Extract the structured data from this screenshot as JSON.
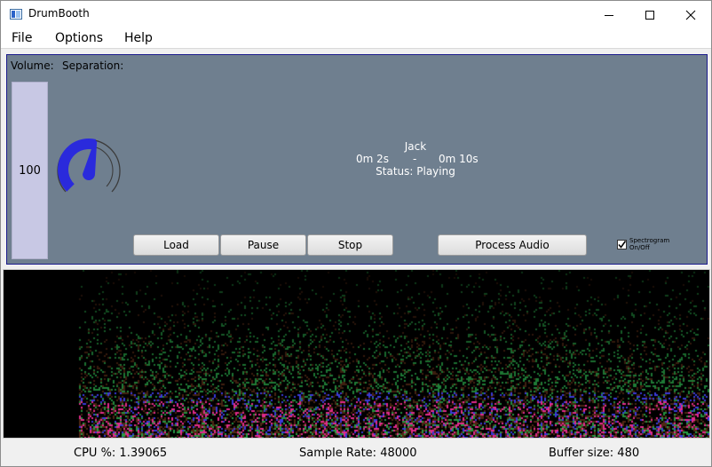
{
  "window": {
    "title": "DrumBooth",
    "icon": "app-icon"
  },
  "titlebar_buttons": {
    "minimize": "minimize-icon",
    "maximize": "maximize-icon",
    "close": "close-icon"
  },
  "menu": [
    "File",
    "Options",
    "Help"
  ],
  "controls": {
    "volume_label": "Volume:",
    "separation_label": "Separation:",
    "volume_value": "100",
    "separation_level": 0.55,
    "colors": {
      "panel": "#6f7f8f",
      "knob_fill": "#2a2adc",
      "slider": "#c8c8e4"
    }
  },
  "track": {
    "name": "Jack",
    "current_time": "0m 2s",
    "separator": "-",
    "total_time": "0m 10s",
    "status": "Status: Playing"
  },
  "buttons": {
    "load": "Load",
    "pause": "Pause",
    "stop": "Stop",
    "process": "Process Audio"
  },
  "spectrogram_toggle": {
    "label_line1": "Spectrogram",
    "label_line2": "On/Off",
    "checked": true
  },
  "status": {
    "cpu": "CPU %: 1.39065",
    "sample_rate": "Sample Rate: 48000",
    "buffer_size": "Buffer size: 480"
  }
}
